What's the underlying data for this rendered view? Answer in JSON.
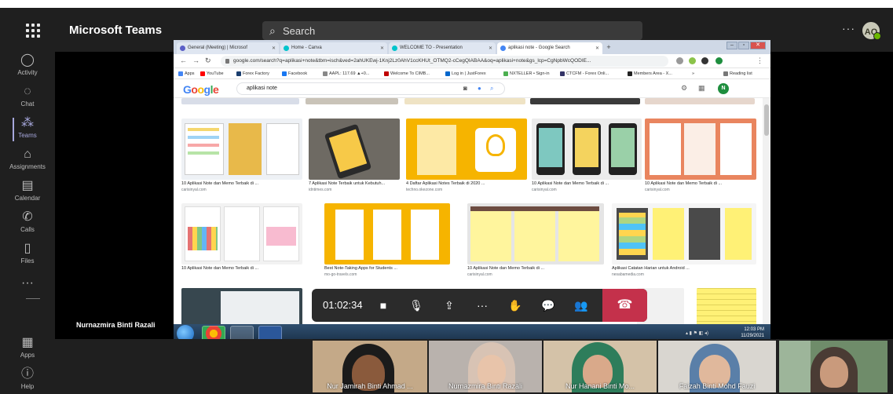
{
  "teams": {
    "app_title": "Microsoft Teams",
    "search_placeholder": "Search",
    "more_label": "···",
    "avatar_initials": "AQ",
    "rail": [
      {
        "label": "Activity",
        "icon": "bell-icon",
        "glyph": "🔔"
      },
      {
        "label": "Chat",
        "icon": "chat-icon",
        "glyph": "💬"
      },
      {
        "label": "Teams",
        "icon": "teams-icon",
        "glyph": "👥"
      },
      {
        "label": "Assignments",
        "icon": "assignments-icon",
        "glyph": "🎒"
      },
      {
        "label": "Calendar",
        "icon": "calendar-icon",
        "glyph": "📅"
      },
      {
        "label": "Calls",
        "icon": "phone-icon",
        "glyph": "📞"
      },
      {
        "label": "Files",
        "icon": "file-icon",
        "glyph": "📄"
      },
      {
        "label": "Apps",
        "icon": "apps-icon",
        "glyph": "▦"
      },
      {
        "label": "Help",
        "icon": "help-icon",
        "glyph": "?"
      }
    ],
    "rail_more": "···",
    "presenter_name": "Nurnazmira Binti Razali",
    "call_timer": "01:02:34",
    "participants": [
      {
        "name": "Nur Jamirah Binti Ahmad ..."
      },
      {
        "name": "Nurnazmira Binti Razali"
      },
      {
        "name": "Nur Hanani Binti Mo..."
      },
      {
        "name": "Faizah Binti Mohd Fauzi"
      },
      {
        "name": ""
      }
    ]
  },
  "browser": {
    "tabs": [
      {
        "title": "General (Meeting) | Microsof",
        "color": "#5b5fc7"
      },
      {
        "title": "Home - Canva",
        "color": "#00c4cc"
      },
      {
        "title": "WELCOME TO - Presentation",
        "color": "#00c4cc"
      },
      {
        "title": "aplikasi note - Google Search",
        "color": "#4285f4"
      }
    ],
    "url": "google.com/search?q=aplikasi+note&tbm=isch&ved=2ahUKEwj-1Knj2Lz0AhV1ccKHUt_OTMQ2-cCegQIABAA&oq=aplikasi+note&gs_lcp=CgNpbWcQODIE...",
    "bookmarks": [
      {
        "label": "Apps",
        "color": "#4285f4"
      },
      {
        "label": "YouTube",
        "color": "#ff0000"
      },
      {
        "label": "Forex Factory",
        "color": "#1a3e6e"
      },
      {
        "label": "Facebook",
        "color": "#1877f2"
      },
      {
        "label": "AAPL: 117.69 ▲+0...",
        "color": "#888888"
      },
      {
        "label": "Welcome To CIMB...",
        "color": "#c00000"
      },
      {
        "label": "Log in | JustForex",
        "color": "#0066cc"
      },
      {
        "label": "NXTELLER • Sign-in",
        "color": "#4caf50"
      },
      {
        "label": "CTCFM - Forex Onli...",
        "color": "#333366"
      },
      {
        "label": "Members Area - X...",
        "color": "#222222"
      },
      {
        "label": "»",
        "color": "#ffffff"
      },
      {
        "label": "Reading list",
        "color": "#777777"
      }
    ],
    "google_logo": [
      "G",
      "o",
      "o",
      "g",
      "l",
      "e"
    ],
    "query": "aplikasi note",
    "user_initial": "N",
    "results": [
      {
        "caption": "10 Aplikasi Note dan Memo Terbaik di ...",
        "source": "carisinyal.com"
      },
      {
        "caption": "7 Aplikasi Note Terbaik untuk Kebutuh...",
        "source": "idntimes.com"
      },
      {
        "caption": "4 Daftar Aplikasi Notes Terbaik di 2020 ...",
        "source": "techno.okezone.com"
      },
      {
        "caption": "10 Aplikasi Note dan Memo Terbaik di ...",
        "source": "carisinyal.com"
      },
      {
        "caption": "10 Aplikasi Note dan Memo Terbaik di ...",
        "source": "carisinyal.com"
      },
      {
        "caption": "10 Aplikasi Note dan Memo Terbaik di ...",
        "source": "carisinyal.com"
      },
      {
        "caption": "Best Note-Taking Apps for Students ...",
        "source": "mo-go-travels.com"
      },
      {
        "caption": "10 Aplikasi Note dan Memo Terbaik di ...",
        "source": "carisinyal.com"
      },
      {
        "caption": "Aplikasi Catatan Harian untuk Android ...",
        "source": "nesabamedia.com"
      }
    ],
    "tray_time": "12:03 PM",
    "tray_date": "11/29/2021"
  },
  "colors": {
    "teams_accent": "#a6a7dc",
    "hangup": "#c4314b",
    "rail_bg": "#1f1f1f"
  }
}
